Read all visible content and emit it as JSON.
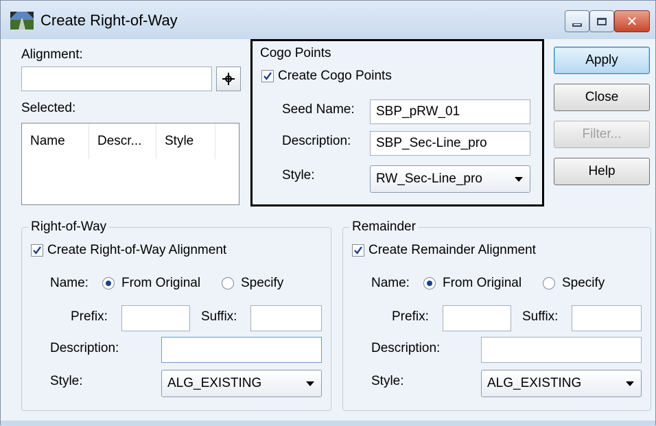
{
  "window": {
    "title": "Create Right-of-Way",
    "close_glyph": "✕"
  },
  "alignment": {
    "label": "Alignment:",
    "value": "",
    "pick_icon": "crosshair-icon"
  },
  "selected": {
    "label": "Selected:",
    "columns": [
      "Name",
      "Descr...",
      "Style"
    ]
  },
  "cogo": {
    "group_title": "Cogo Points",
    "create_label": "Create Cogo Points",
    "create_checked": true,
    "seed_name_label": "Seed Name:",
    "seed_name_value": "SBP_pRW_01",
    "description_label": "Description:",
    "description_value": "SBP_Sec-Line_pro",
    "style_label": "Style:",
    "style_value": "RW_Sec-Line_pro"
  },
  "buttons": {
    "apply": "Apply",
    "close": "Close",
    "filter": "Filter...",
    "help": "Help"
  },
  "right_of_way": {
    "group_title": "Right-of-Way",
    "create_label": "Create Right-of-Way Alignment",
    "create_checked": true,
    "name_label": "Name:",
    "from_original": "From Original",
    "specify": "Specify",
    "selected_option": "From Original",
    "prefix_label": "Prefix:",
    "prefix_value": "",
    "suffix_label": "Suffix:",
    "suffix_value": "",
    "description_label": "Description:",
    "description_value": "",
    "style_label": "Style:",
    "style_value": "ALG_EXISTING"
  },
  "remainder": {
    "group_title": "Remainder",
    "create_label": "Create Remainder Alignment",
    "create_checked": true,
    "name_label": "Name:",
    "from_original": "From Original",
    "specify": "Specify",
    "selected_option": "From Original",
    "prefix_label": "Prefix:",
    "prefix_value": "",
    "suffix_label": "Suffix:",
    "suffix_value": "",
    "description_label": "Description:",
    "description_value": "",
    "style_label": "Style:",
    "style_value": "ALG_EXISTING"
  },
  "colors": {
    "dialog_bg": "#eef3f9",
    "close_button": "#c8452c",
    "highlight_border": "#000000"
  }
}
